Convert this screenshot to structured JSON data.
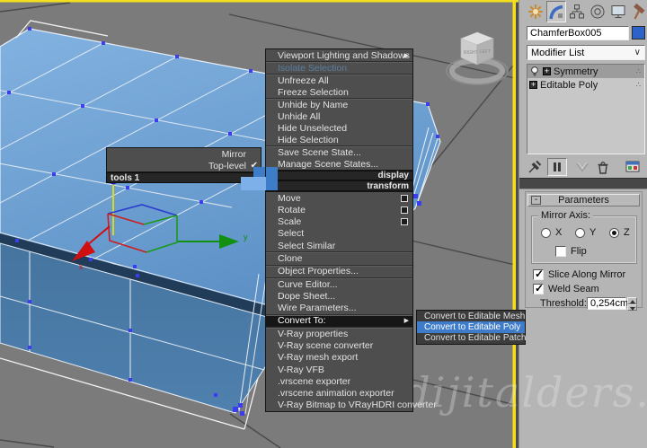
{
  "viewport": {
    "watermark": "www.dijitalders.com",
    "active_border_color": "#f2df1e",
    "gizmo": {
      "x_axis_label": "x",
      "y_axis_label": "y"
    },
    "viewcube": {
      "left_face": "RIGHT",
      "right_face": "LEFT"
    }
  },
  "quad_menu": {
    "left_quad": {
      "title": "tools 1",
      "items": [
        {
          "label": "Mirror"
        },
        {
          "label": "Top-level",
          "checkmark": "✔"
        }
      ]
    },
    "display_quad": {
      "title": "display",
      "items": [
        "Viewport Lighting and Shadows",
        "Isolate Selection",
        "Unfreeze All",
        "Freeze Selection",
        "Unhide by Name",
        "Unhide All",
        "Hide Unselected",
        "Hide Selection",
        "Save Scene State...",
        "Manage Scene States..."
      ]
    },
    "transform_quad": {
      "title": "transform",
      "items": [
        "Move",
        "Rotate",
        "Scale",
        "Select",
        "Select Similar",
        "Clone",
        "Object Properties...",
        "Curve Editor...",
        "Dope Sheet...",
        "Wire Parameters...",
        "Convert To:",
        "V-Ray properties",
        "V-Ray scene converter",
        "V-Ray mesh export",
        "V-Ray VFB",
        ".vrscene exporter",
        ".vrscene animation exporter",
        "V-Ray Bitmap to VRayHDRI converter"
      ]
    },
    "convert_submenu": {
      "items": [
        "Convert to Editable Mesh",
        "Convert to Editable Poly",
        "Convert to Editable Patch"
      ],
      "highlighted": "Convert to Editable Poly",
      "highlight_color": "#3e7cc9"
    }
  },
  "command_panel": {
    "tabs": [
      {
        "name": "create"
      },
      {
        "name": "modify",
        "active": true
      },
      {
        "name": "hierarchy"
      },
      {
        "name": "motion"
      },
      {
        "name": "display"
      },
      {
        "name": "utilities"
      }
    ],
    "object_name": "ChamferBox005",
    "object_color": "#2c63c8",
    "modifier_list": {
      "label": "Modifier List"
    },
    "modifier_stack": [
      {
        "label": "Symmetry",
        "selected": true,
        "has_bulb": true
      },
      {
        "label": "Editable Poly",
        "selected": false,
        "has_bulb": false
      }
    ],
    "parameters": {
      "rollout_title": "Parameters",
      "collapse_glyph": "-",
      "mirror_axis": {
        "group_label": "Mirror Axis:",
        "options": [
          "X",
          "Y",
          "Z"
        ],
        "selected": "Z",
        "flip_label": "Flip",
        "flip_checked": false
      },
      "slice_label": "Slice Along Mirror",
      "slice_checked": true,
      "weld_label": "Weld Seam",
      "weld_checked": true,
      "threshold_label": "Threshold:",
      "threshold_value": "0,254cm"
    }
  }
}
